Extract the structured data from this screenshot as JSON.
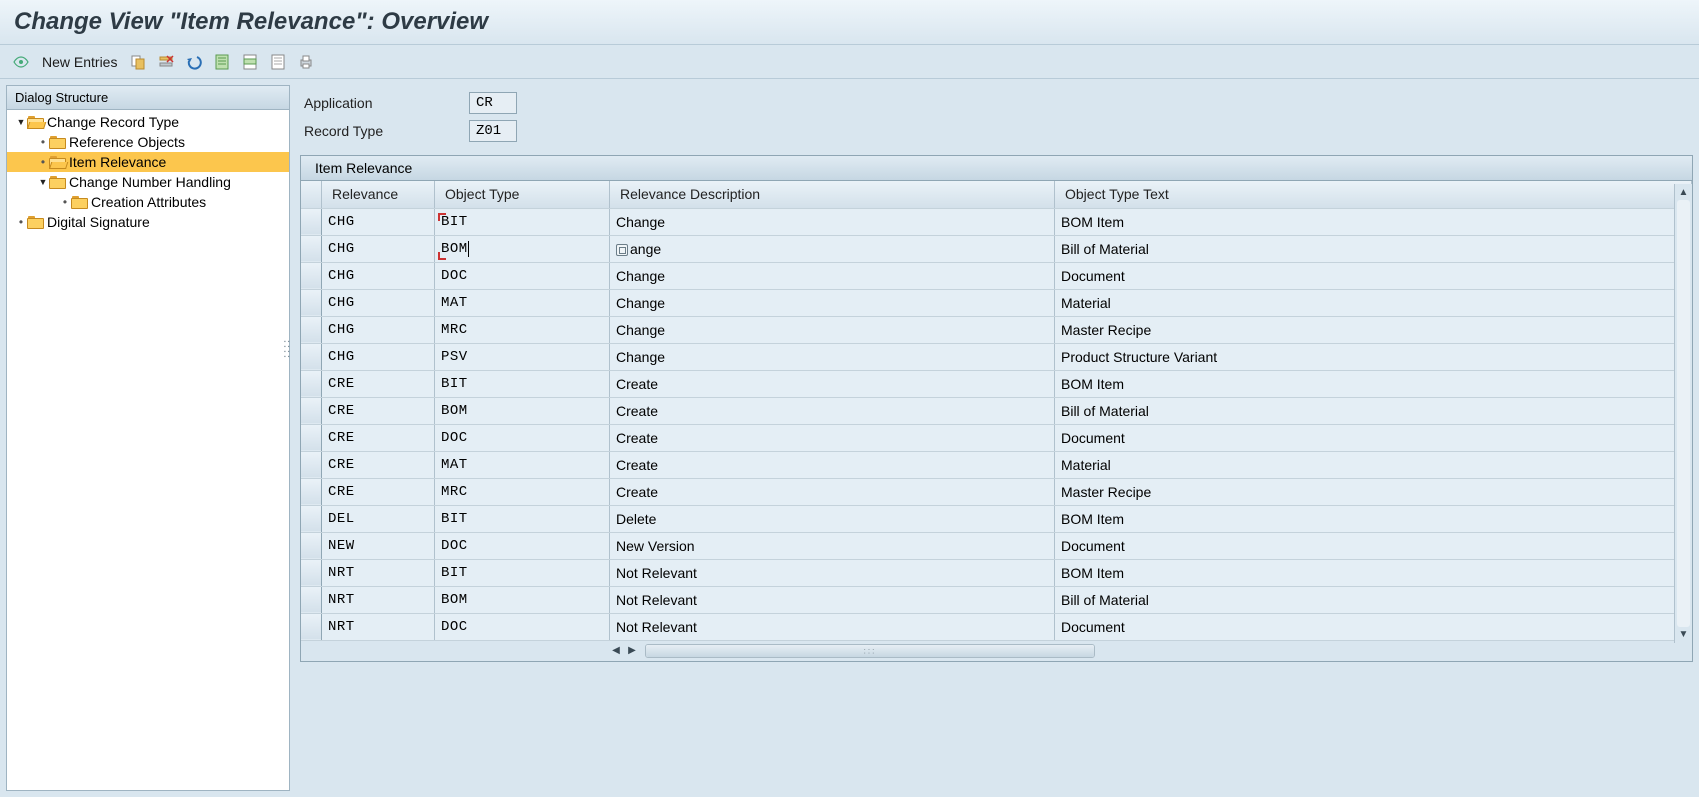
{
  "title": "Change View \"Item Relevance\": Overview",
  "toolbar": {
    "glasses_tip": "Display / Change",
    "new_entries": "New Entries",
    "icons": [
      "copy-icon",
      "delete-icon",
      "undo-icon",
      "select-all-icon",
      "select-block-icon",
      "deselect-all-icon",
      "print-icon"
    ]
  },
  "tree": {
    "header": "Dialog Structure",
    "nodes": [
      {
        "level": 0,
        "toggle": "▾",
        "icon": "open",
        "label": "Change Record Type"
      },
      {
        "level": 1,
        "toggle": "•",
        "icon": "closed",
        "label": "Reference Objects"
      },
      {
        "level": 1,
        "toggle": "•",
        "icon": "open",
        "label": "Item Relevance",
        "selected": true
      },
      {
        "level": 1,
        "toggle": "▾",
        "icon": "closed",
        "label": "Change Number Handling"
      },
      {
        "level": 2,
        "toggle": "•",
        "icon": "closed",
        "label": "Creation Attributes"
      },
      {
        "level": 0,
        "toggle": "•",
        "icon": "closed",
        "label": "Digital Signature"
      }
    ]
  },
  "form": {
    "application_label": "Application",
    "application_value": "CR",
    "record_type_label": "Record Type",
    "record_type_value": "Z01"
  },
  "grid": {
    "title": "Item Relevance",
    "columns": [
      "Relevance",
      "Object Type",
      "Relevance Description",
      "Object Type Text"
    ],
    "rows": [
      {
        "rel": "CHG",
        "obj": "BIT",
        "desc": "Change",
        "text": "BOM Item",
        "edit_obj": false,
        "caret_top": true
      },
      {
        "rel": "CHG",
        "obj": "BOM",
        "desc": "ange",
        "text": "Bill of Material",
        "edit_obj": true,
        "f4": true,
        "caret_bot": true
      },
      {
        "rel": "CHG",
        "obj": "DOC",
        "desc": "Change",
        "text": "Document"
      },
      {
        "rel": "CHG",
        "obj": "MAT",
        "desc": "Change",
        "text": "Material"
      },
      {
        "rel": "CHG",
        "obj": "MRC",
        "desc": "Change",
        "text": "Master Recipe"
      },
      {
        "rel": "CHG",
        "obj": "PSV",
        "desc": "Change",
        "text": "Product Structure Variant"
      },
      {
        "rel": "CRE",
        "obj": "BIT",
        "desc": "Create",
        "text": "BOM Item"
      },
      {
        "rel": "CRE",
        "obj": "BOM",
        "desc": "Create",
        "text": "Bill of Material"
      },
      {
        "rel": "CRE",
        "obj": "DOC",
        "desc": "Create",
        "text": "Document"
      },
      {
        "rel": "CRE",
        "obj": "MAT",
        "desc": "Create",
        "text": "Material"
      },
      {
        "rel": "CRE",
        "obj": "MRC",
        "desc": "Create",
        "text": "Master Recipe"
      },
      {
        "rel": "DEL",
        "obj": "BIT",
        "desc": "Delete",
        "text": "BOM Item"
      },
      {
        "rel": "NEW",
        "obj": "DOC",
        "desc": "New Version",
        "text": "Document"
      },
      {
        "rel": "NRT",
        "obj": "BIT",
        "desc": "Not Relevant",
        "text": "BOM Item"
      },
      {
        "rel": "NRT",
        "obj": "BOM",
        "desc": "Not Relevant",
        "text": "Bill of Material"
      },
      {
        "rel": "NRT",
        "obj": "DOC",
        "desc": "Not Relevant",
        "text": "Document"
      }
    ]
  }
}
